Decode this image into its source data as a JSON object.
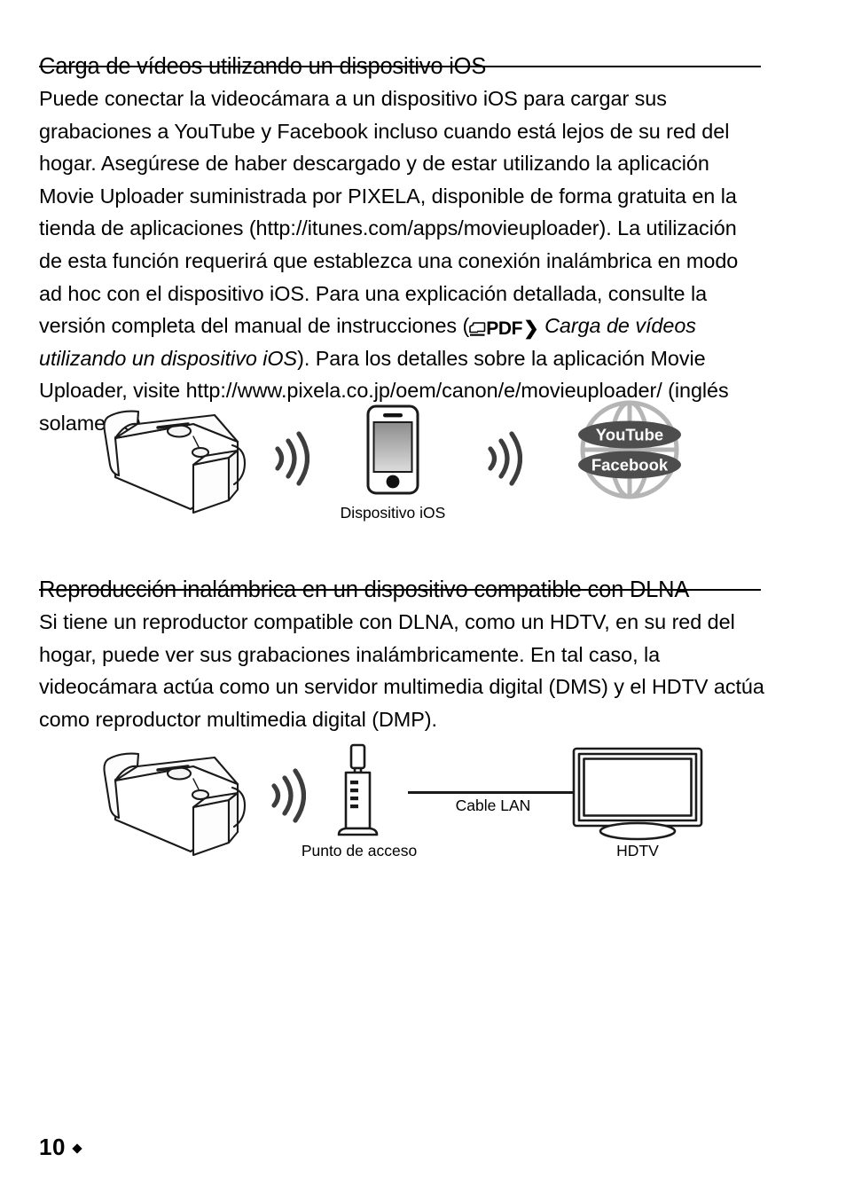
{
  "page": {
    "number": "10",
    "bullet": "diamond"
  },
  "sections": [
    {
      "id": "ios-upload",
      "heading": "Carga de vídeos utilizando un dispositivo iOS",
      "paragraph_part1": "Puede conectar la videocámara a un dispositivo iOS para cargar sus grabaciones a YouTube y Facebook incluso cuando está lejos de su red del hogar. Asegúrese de haber descargado y de estar utilizando la aplicación Movie Uploader suministrada por PIXELA, disponible de forma gratuita en la tienda de aplicaciones (http://itunes.com/apps/movieuploader). La utilización de esta función requerirá que establezca una conexión inalámbrica en modo ad hoc con el dispositivo iOS. Para una explicación detallada, consulte la versión completa del manual de instrucciones (",
      "pdf_badge_label": "PDF",
      "pdf_badge_arrow": "❯",
      "paragraph_italic": "Carga de vídeos utilizando un dispositivo iOS",
      "paragraph_part2": "). Para los detalles sobre la aplicación Movie Uploader, visite http://www.pixela.co.jp/oem/canon/e/movieuploader/ (inglés solamente).",
      "figure": {
        "caption_device": "Dispositivo iOS",
        "globe_labels": [
          "YouTube",
          "Facebook"
        ]
      }
    },
    {
      "id": "dlna-playback",
      "heading": "Reproducción inalámbrica en un dispositivo compatible con DLNA",
      "paragraph": "Si tiene un reproductor compatible con DLNA, como un HDTV, en su red del hogar, puede ver sus grabaciones inalámbricamente. En tal caso, la videocámara actúa como un servidor multimedia digital (DMS) y el HDTV actúa como reproductor multimedia digital (DMP).",
      "figure": {
        "caption_access_point": "Punto de acceso",
        "caption_cable": "Cable LAN",
        "caption_hdtv": "HDTV"
      }
    }
  ],
  "colors": {
    "text": "#000000",
    "rule": "#000000",
    "wave": "#3d3d3d",
    "globe_sphere": "#b5b5b5",
    "globe_label_bg": "#4d4d4d",
    "globe_label_text": "#ffffff",
    "phone_screen_top": "#8c8c8c",
    "phone_screen_bottom": "#d8d8d8",
    "line_art": "#1a1a1a"
  }
}
